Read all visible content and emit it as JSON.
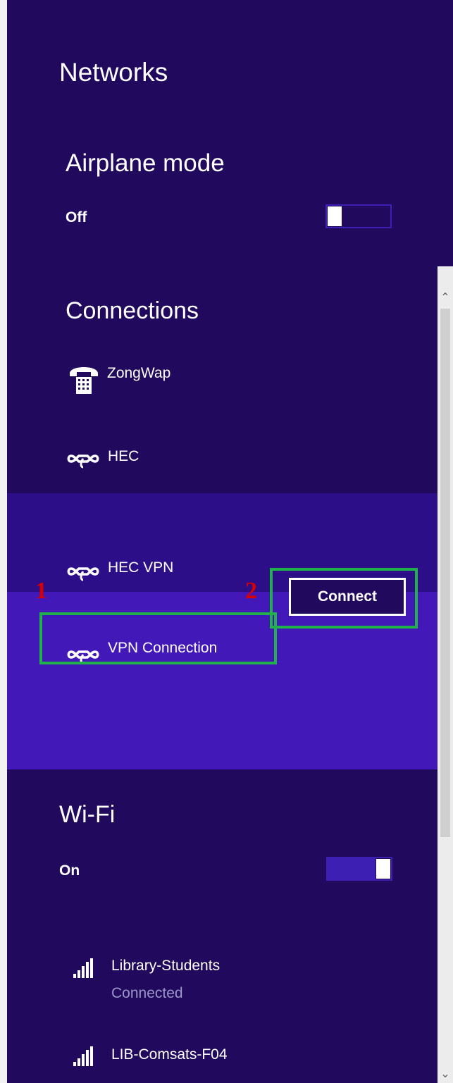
{
  "panel": {
    "title": "Networks"
  },
  "airplane": {
    "heading": "Airplane mode",
    "state_label": "Off",
    "on": false
  },
  "connections": {
    "heading": "Connections",
    "items": [
      {
        "name": "ZongWap",
        "icon": "phone-dialup-icon"
      },
      {
        "name": "HEC",
        "icon": "vpn-link-icon"
      },
      {
        "name": "HEC VPN",
        "icon": "vpn-link-icon"
      },
      {
        "name": "VPN Connection",
        "icon": "vpn-link-icon",
        "action_label": "Connect"
      }
    ]
  },
  "wifi": {
    "heading": "Wi-Fi",
    "state_label": "On",
    "on": true,
    "networks": [
      {
        "name": "Library-Students",
        "status": "Connected",
        "icon": "wifi-signal-icon"
      },
      {
        "name": "LIB-Comsats-F04",
        "icon": "wifi-signal-icon"
      }
    ]
  },
  "annotations": {
    "marker_1": "1",
    "marker_2": "2"
  },
  "colors": {
    "panel_bg": "#21095e",
    "hover_row": "#2c0f88",
    "selected_row": "#4318b8",
    "toggle_accent": "#3d1fb3",
    "highlight_box": "#20b14a",
    "marker_red": "#d80000"
  }
}
